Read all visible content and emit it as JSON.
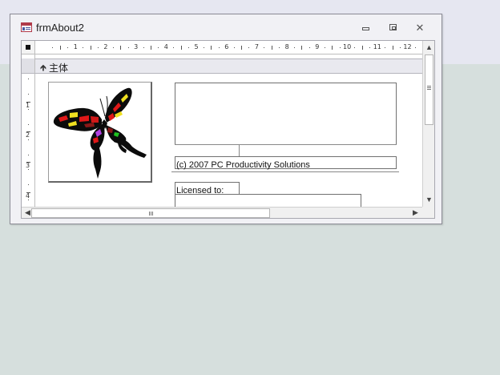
{
  "window": {
    "title": "frmAbout2",
    "icon": "form-icon"
  },
  "ruler": {
    "horizontal_numbers": [
      "1",
      "2",
      "3",
      "4",
      "5",
      "6",
      "7",
      "8",
      "9",
      "10",
      "11",
      "12"
    ],
    "vertical_numbers": [
      "1",
      "2",
      "3",
      "4"
    ]
  },
  "section": {
    "arrow_icon": "section-collapse-arrow-icon",
    "label": "主体"
  },
  "form": {
    "logo_icon": "butterfly-logo",
    "copyright": "(c) 2007 PC Productivity Solutions",
    "licensed_label": "Licensed to:"
  },
  "colors": {
    "window_border": "#8b8b95",
    "section_bar": "#e9e9ef",
    "background": "#d6dfdd"
  }
}
